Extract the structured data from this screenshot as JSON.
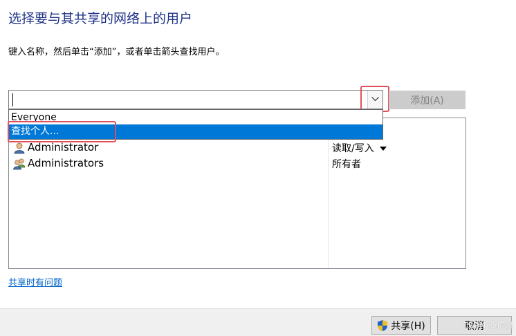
{
  "header": {
    "title": "选择要与其共享的网络上的用户",
    "instruction": "键入名称，然后单击“添加”，或者单击箭头查找用户。"
  },
  "name_input": {
    "value": ""
  },
  "add_button": {
    "label": "添加(A)"
  },
  "dropdown": {
    "items": [
      {
        "label": "Everyone"
      },
      {
        "label": "查找个人...",
        "selected": true
      }
    ]
  },
  "users": [
    {
      "name": "Administrator",
      "permission": "读取/写入",
      "has_menu": true,
      "icon": "user-icon"
    },
    {
      "name": "Administrators",
      "permission": "所有者",
      "has_menu": false,
      "icon": "users-group-icon"
    }
  ],
  "help_link": {
    "label": "共享时有问题"
  },
  "footer": {
    "share_label": "共享(H)",
    "cancel_label": "取消",
    "watermark": "CSDN @梅洪"
  },
  "colors": {
    "title": "#1e3287",
    "selection": "#0078d7",
    "highlight_box": "#e0505c",
    "link": "#0066cc"
  }
}
